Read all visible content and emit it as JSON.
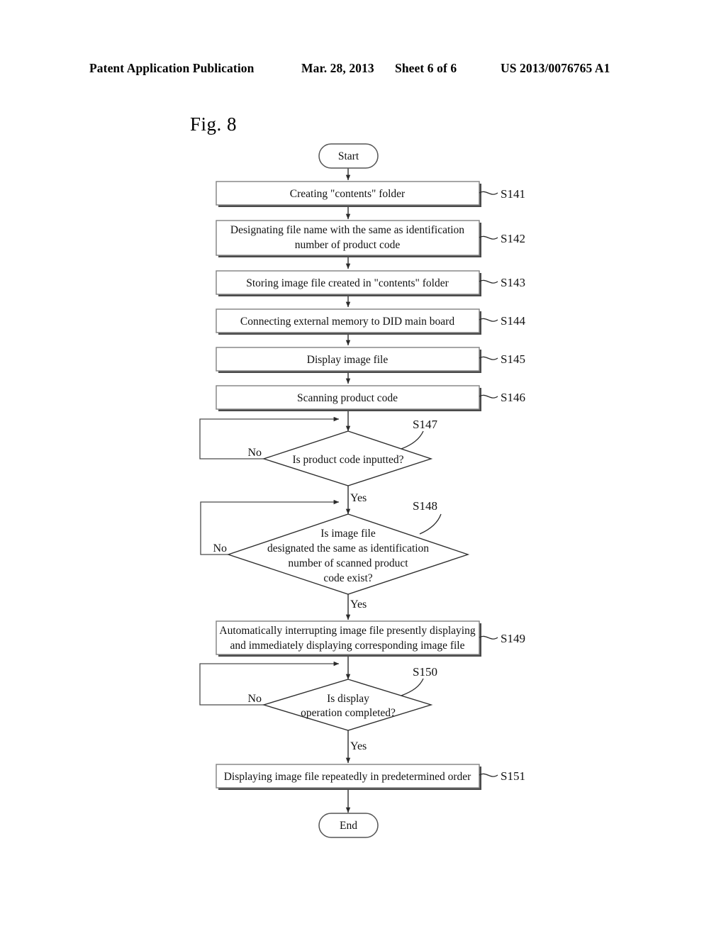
{
  "header": {
    "publication": "Patent Application Publication",
    "date": "Mar. 28, 2013",
    "sheet": "Sheet 6 of 6",
    "number": "US 2013/0076765 A1"
  },
  "figure": {
    "label": "Fig. 8"
  },
  "flowchart": {
    "start_label": "Start",
    "end_label": "End",
    "yes_label": "Yes",
    "no_label": "No",
    "steps": [
      {
        "id": "S141",
        "type": "process",
        "lines": [
          "Creating \"contents\" folder"
        ]
      },
      {
        "id": "S142",
        "type": "process",
        "lines": [
          "Designating file name with the same as identification",
          "number of product code"
        ]
      },
      {
        "id": "S143",
        "type": "process",
        "lines": [
          "Storing image file created in \"contents\" folder"
        ]
      },
      {
        "id": "S144",
        "type": "process",
        "lines": [
          "Connecting external memory to DID main board"
        ]
      },
      {
        "id": "S145",
        "type": "process",
        "lines": [
          "Display image file"
        ]
      },
      {
        "id": "S146",
        "type": "process",
        "lines": [
          "Scanning product code"
        ]
      },
      {
        "id": "S147",
        "type": "decision",
        "lines": [
          "Is product code inputted?"
        ]
      },
      {
        "id": "S148",
        "type": "decision",
        "lines": [
          "Is image file",
          "designated the same as identification",
          "number of scanned product",
          "code exist?"
        ]
      },
      {
        "id": "S149",
        "type": "process",
        "lines": [
          "Automatically interrupting image file presently displaying",
          "and immediately displaying corresponding image file"
        ]
      },
      {
        "id": "S150",
        "type": "decision",
        "lines": [
          "Is display",
          "operation completed?"
        ]
      },
      {
        "id": "S151",
        "type": "process",
        "lines": [
          "Displaying image file repeatedly in predetermined order"
        ]
      }
    ]
  },
  "colors": {
    "ink": "#111111",
    "box_stroke": "#808080",
    "line": "#2b2b2b",
    "background": "#ffffff"
  }
}
